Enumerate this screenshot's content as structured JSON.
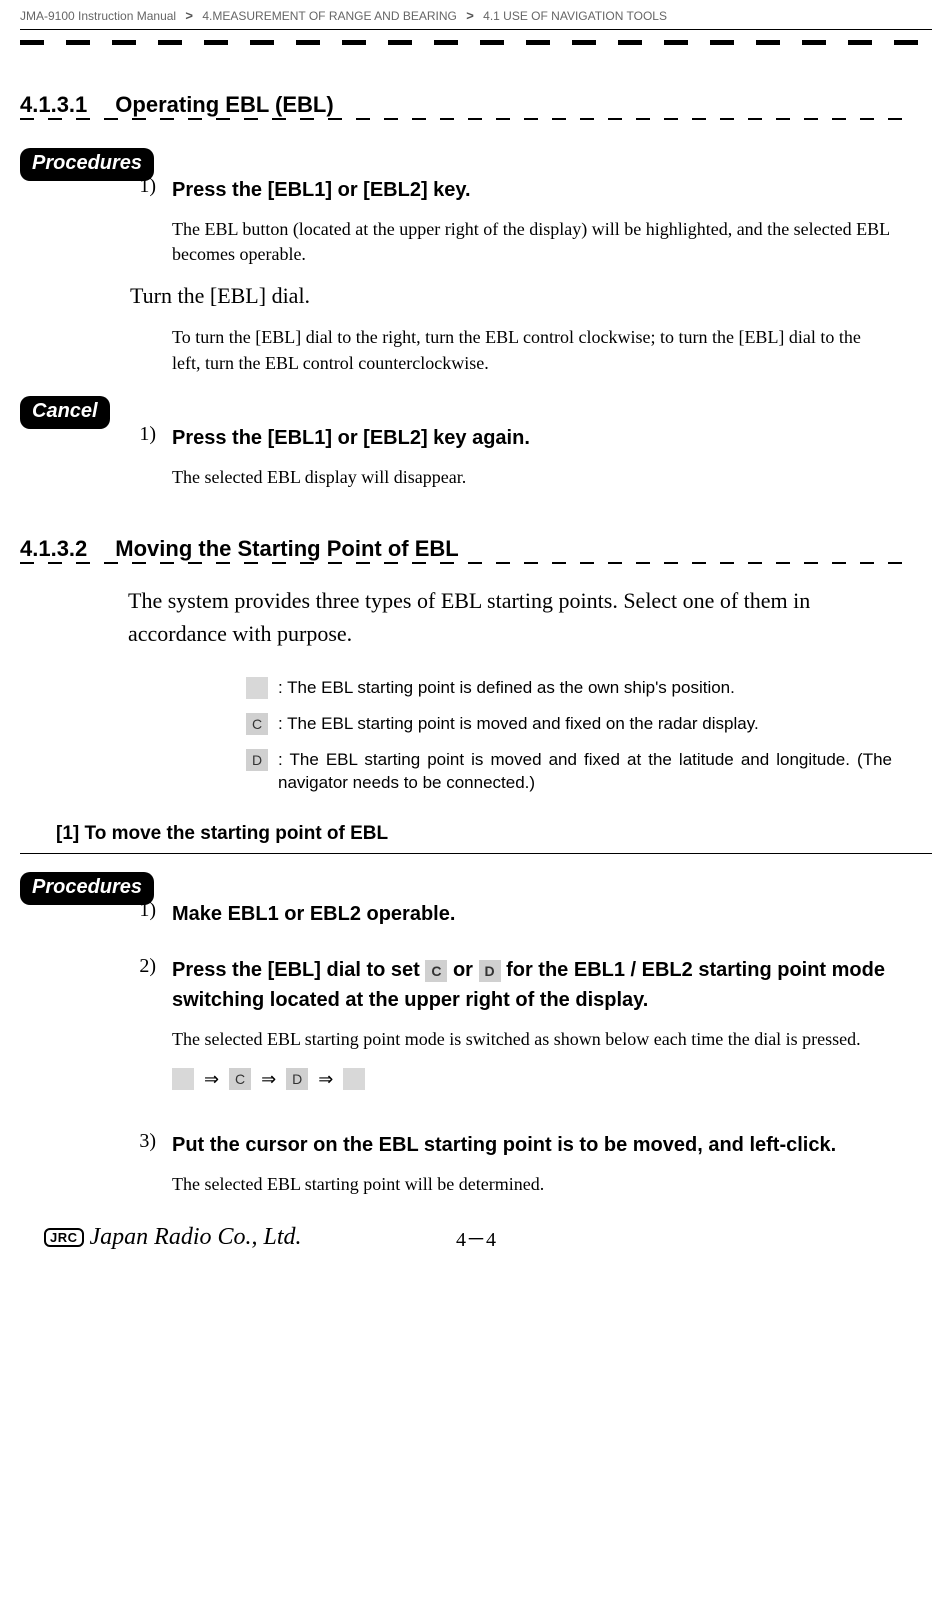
{
  "header": {
    "manual": "JMA-9100 Instruction Manual",
    "chapter": "4.MEASUREMENT OF RANGE AND BEARING",
    "section": "4.1  USE OF NAVIGATION TOOLS",
    "sep": ">"
  },
  "s1": {
    "num": "4.1.3.1",
    "title": "Operating EBL (EBL)",
    "procedures_label": "Procedures",
    "step1_num": "1)",
    "step1_title": "Press the [EBL1] or [EBL2] key.",
    "step1_body": "The  EBL  button (located at the upper right of the display) will be highlighted, and the selected EBL becomes operable.",
    "plain": "Turn the [EBL] dial.",
    "plain_body": "To turn the [EBL] dial to the right, turn the EBL control clockwise; to turn the [EBL] dial to the left, turn the EBL control counterclockwise.",
    "cancel_label": "Cancel",
    "cancel_step_num": "1)",
    "cancel_step_title": "Press the [EBL1] or [EBL2] key again.",
    "cancel_body": "The selected EBL display will disappear."
  },
  "s2": {
    "num": "4.1.3.2",
    "title": "Moving the Starting Point of EBL",
    "intro": "The system provides three types of EBL starting points.  Select one of them in accordance with purpose.",
    "legend_blank_desc": ": The EBL starting point is defined as the own ship's position.",
    "legend_c": "C",
    "legend_c_desc": ": The EBL starting point is moved and fixed on the radar display.",
    "legend_d": "D",
    "legend_d_desc": ": The EBL starting point is moved and fixed at the latitude and longitude. (The navigator needs to be connected.)",
    "sub": "[1] To move the starting point of EBL",
    "procedures_label": "Procedures",
    "step1_num": "1)",
    "step1_title": "Make EBL1 or EBL2 operable.",
    "step2_num": "2)",
    "step2_title_a": " Press the [EBL] dial to set ",
    "step2_title_b": " or ",
    "step2_title_c": " for the EBL1 / EBL2 starting point mode switching located at the upper right of the display.",
    "step2_body": "The selected EBL starting point mode is switched as shown below each time the dial is pressed.",
    "cycle_c": "C",
    "cycle_d": "D",
    "arrow": "⇒",
    "step3_num": "3)",
    "step3_title": "Put the cursor on the EBL starting point is to be moved, and left-click.",
    "step3_body": "The selected EBL starting point will be determined."
  },
  "footer": {
    "jrc": "JRC",
    "company": "Japan Radio Co., Ltd.",
    "page": "4－4"
  }
}
